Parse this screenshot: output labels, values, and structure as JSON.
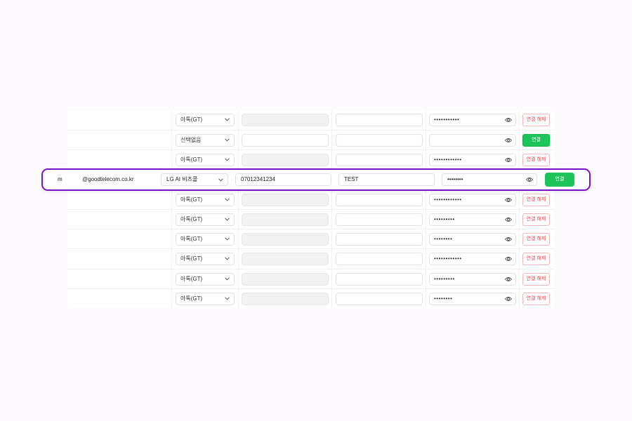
{
  "rows": [
    {
      "provider": "아톡(GT)",
      "password_mask": "•••••••••••",
      "action": "연결 해제",
      "field1_disabled": true
    },
    {
      "provider": "선택없음",
      "password_mask": "",
      "action": "연결",
      "field1_disabled": false
    },
    {
      "provider": "아톡(GT)",
      "password_mask": "••••••••••••",
      "action": "연결 해제",
      "field1_disabled": true
    },
    {
      "provider": "아톡(GT)",
      "password_mask": "••••••••••••",
      "action": "연결 해제",
      "field1_disabled": true
    },
    {
      "provider": "아톡(GT)",
      "password_mask": "•••••••••",
      "action": "연결 해제",
      "field1_disabled": true
    },
    {
      "provider": "아톡(GT)",
      "password_mask": "••••••••",
      "action": "연결 해제",
      "field1_disabled": true
    },
    {
      "provider": "아톡(GT)",
      "password_mask": "••••••••••••",
      "action": "연결 해제",
      "field1_disabled": true
    },
    {
      "provider": "아톡(GT)",
      "password_mask": "•••••••••",
      "action": "연결 해제",
      "field1_disabled": true
    },
    {
      "provider": "아톡(GT)",
      "password_mask": "••••••••",
      "action": "연결 해제",
      "field1_disabled": true
    }
  ],
  "highlight": {
    "user_prefix": "m",
    "email": "@goodtelecom.co.kr",
    "provider": "LG AI 비즈콜",
    "phone": "07012341234",
    "name": "TEST",
    "password_mask": "••••••••",
    "action": "연결"
  },
  "colors": {
    "highlight_border": "#7a11c9",
    "connect_green": "#1cc459",
    "disconnect_red": "#e5484d"
  }
}
